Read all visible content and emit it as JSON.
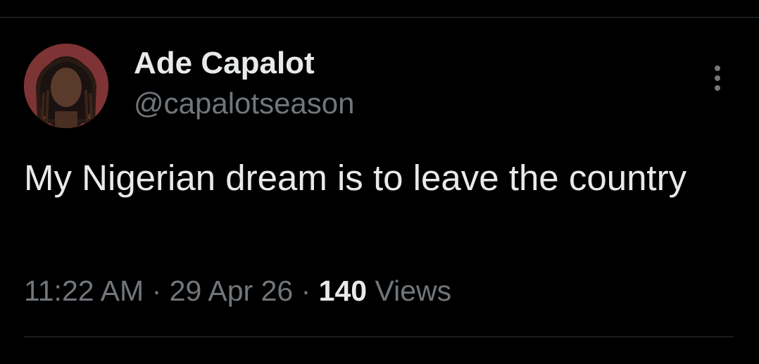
{
  "tweet": {
    "author": {
      "display_name": "Ade Capalot",
      "handle": "@capalotseason",
      "avatar_icon": "profile-photo"
    },
    "text": "My Nigerian dream is to leave the country",
    "time": "11:22 AM",
    "separator": "·",
    "date": "29 Apr 26",
    "views_count": "140",
    "views_label": "Views",
    "more_icon": "vertical-ellipsis-icon"
  },
  "colors": {
    "background": "#000000",
    "primary_text": "#e7e9ea",
    "secondary_text": "#71767b",
    "divider": "#2f3336",
    "avatar_bg": "#8a3a3a"
  }
}
